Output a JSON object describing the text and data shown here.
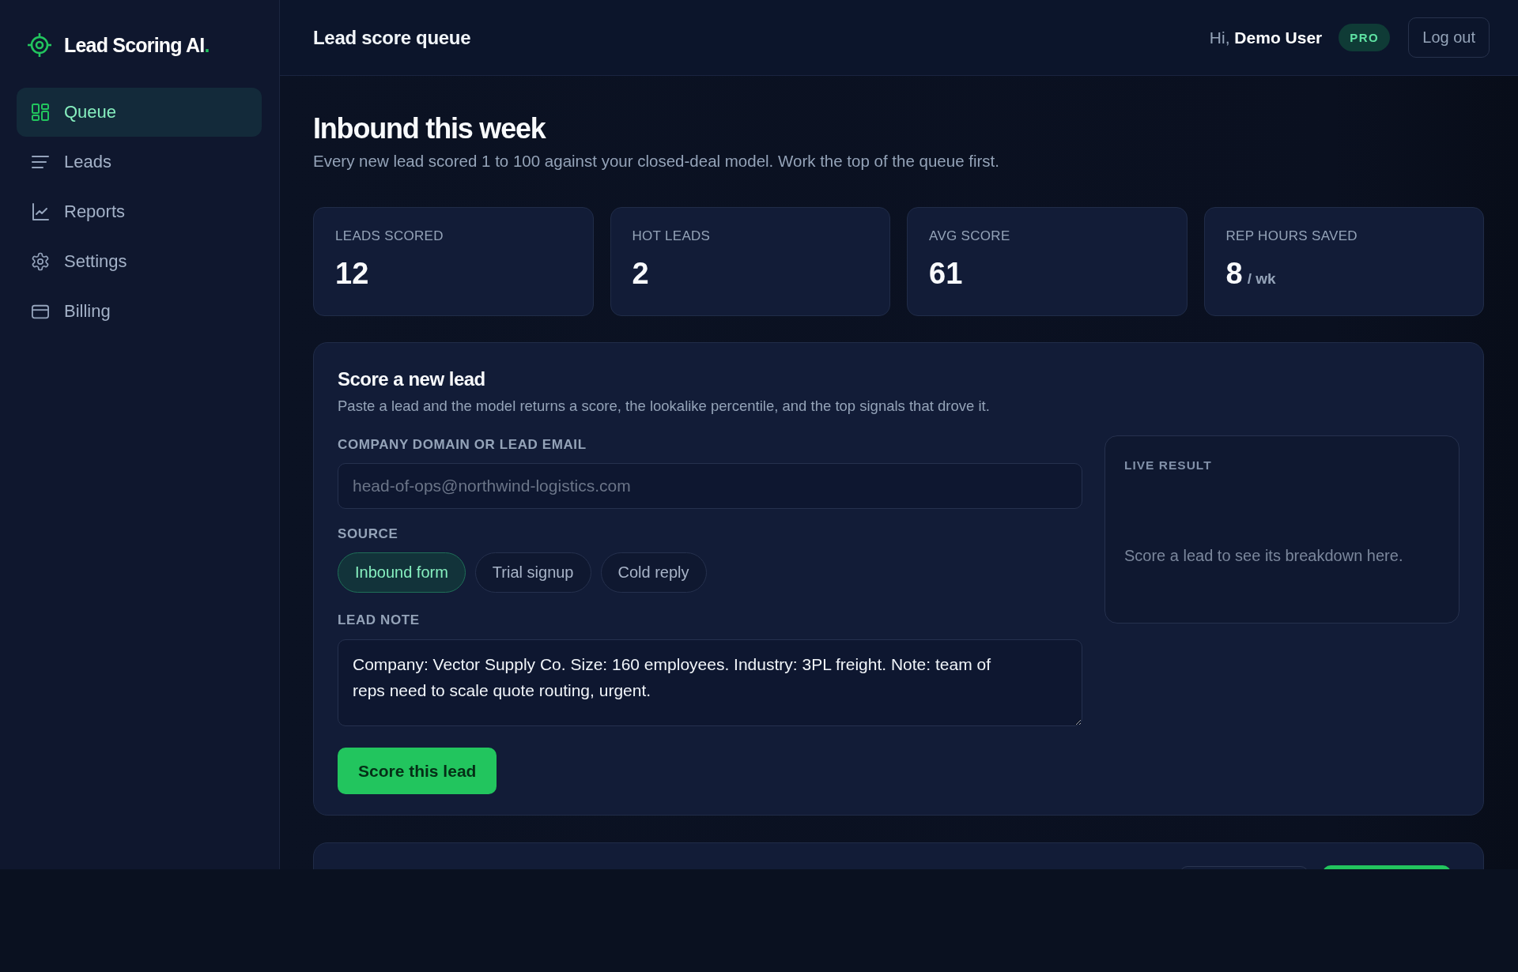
{
  "sidebar": {
    "brand": {
      "name": "Lead Scoring AI",
      "accent": "."
    },
    "items": [
      {
        "label": "Queue",
        "selected": true
      },
      {
        "label": "Leads",
        "selected": false
      },
      {
        "label": "Reports",
        "selected": false
      },
      {
        "label": "Settings",
        "selected": false
      },
      {
        "label": "Billing",
        "selected": false
      }
    ]
  },
  "header": {
    "title": "Lead score queue",
    "greeting": "Hi, **Demo User**",
    "plan_badge": "PRO",
    "logout_button": "Log out"
  },
  "intro": {
    "title": "Inbound this week",
    "subtitle": "Every new lead scored 1 to 100 against your closed-deal model. Work the top of the queue first."
  },
  "stats": [
    {
      "label": "LEADS SCORED",
      "value": "12"
    },
    {
      "label": "HOT LEADS",
      "value": "2"
    },
    {
      "label": "AVG SCORE",
      "value": "61"
    },
    {
      "label": "REP HOURS SAVED",
      "value": "8",
      "unit": "/ wk"
    }
  ],
  "score_form": {
    "title": "Score a new lead",
    "description": "Paste a lead and the model returns a score, the lookalike percentile, and the top signals that drove it.",
    "domain_field": {
      "label": "COMPANY DOMAIN OR LEAD EMAIL",
      "placeholder": "head-of-ops@northwind-logistics.com"
    },
    "source": {
      "label": "SOURCE",
      "options": [
        {
          "label": "Inbound form",
          "selected": true
        },
        {
          "label": "Trial signup",
          "selected": false
        },
        {
          "label": "Cold reply",
          "selected": false
        }
      ]
    },
    "note_field": {
      "label": "LEAD NOTE",
      "value": "Company: Vector Supply Co. Size: 160 employees. Industry: 3PL freight. Note: team of reps need to scale quote routing, urgent."
    },
    "submit_button": "Score this lead",
    "live_result": {
      "label": "LIVE RESULT",
      "empty_text": "Score a lead to see its breakdown here."
    }
  }
}
